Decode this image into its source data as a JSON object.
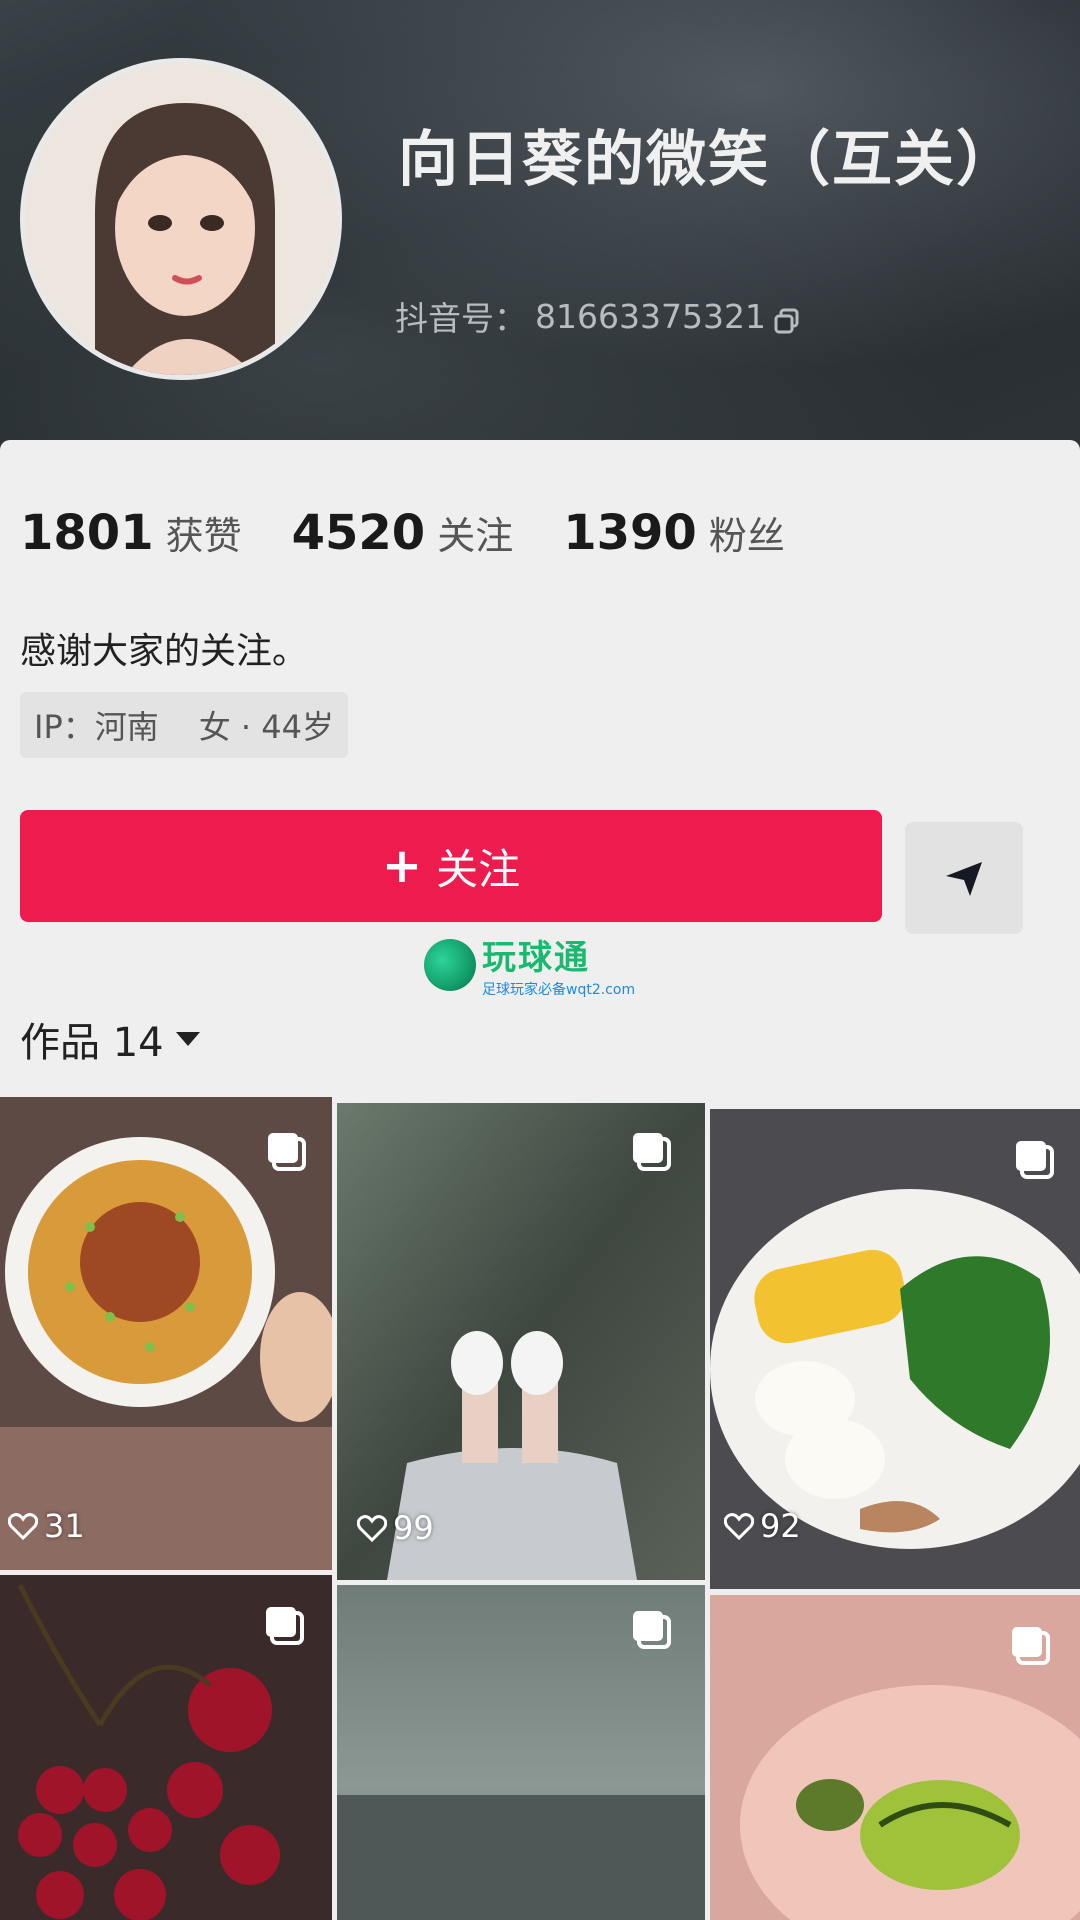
{
  "profile": {
    "nickname": "向日葵的微笑（互关）",
    "douyin_id_label": "抖音号：",
    "douyin_id": "81663375321",
    "bio": "感谢大家的关注。",
    "ip": "IP：河南",
    "gender_age": "女 · 44岁"
  },
  "stats": [
    {
      "value": "1801",
      "label": "获赞"
    },
    {
      "value": "4520",
      "label": "关注"
    },
    {
      "value": "1390",
      "label": "粉丝"
    }
  ],
  "actions": {
    "follow_plus": "+",
    "follow_label": "关注"
  },
  "watermark": {
    "title": "玩球通",
    "subtitle": "足球玩家必备wqt2.com"
  },
  "works": {
    "label": "作品 14"
  },
  "posts": [
    {
      "likes": "31",
      "subject": "tofu-dish"
    },
    {
      "likes": "99",
      "subject": "feet-in-stream"
    },
    {
      "likes": "92",
      "subject": "corn-eggs-greens"
    },
    {
      "likes": "",
      "subject": "cherries"
    },
    {
      "likes": "",
      "subject": "sea-horizon"
    },
    {
      "likes": "",
      "subject": "turtle-in-hand"
    }
  ],
  "colors": {
    "follow_button": "#ee1c4e",
    "panel_bg": "#efefef"
  }
}
